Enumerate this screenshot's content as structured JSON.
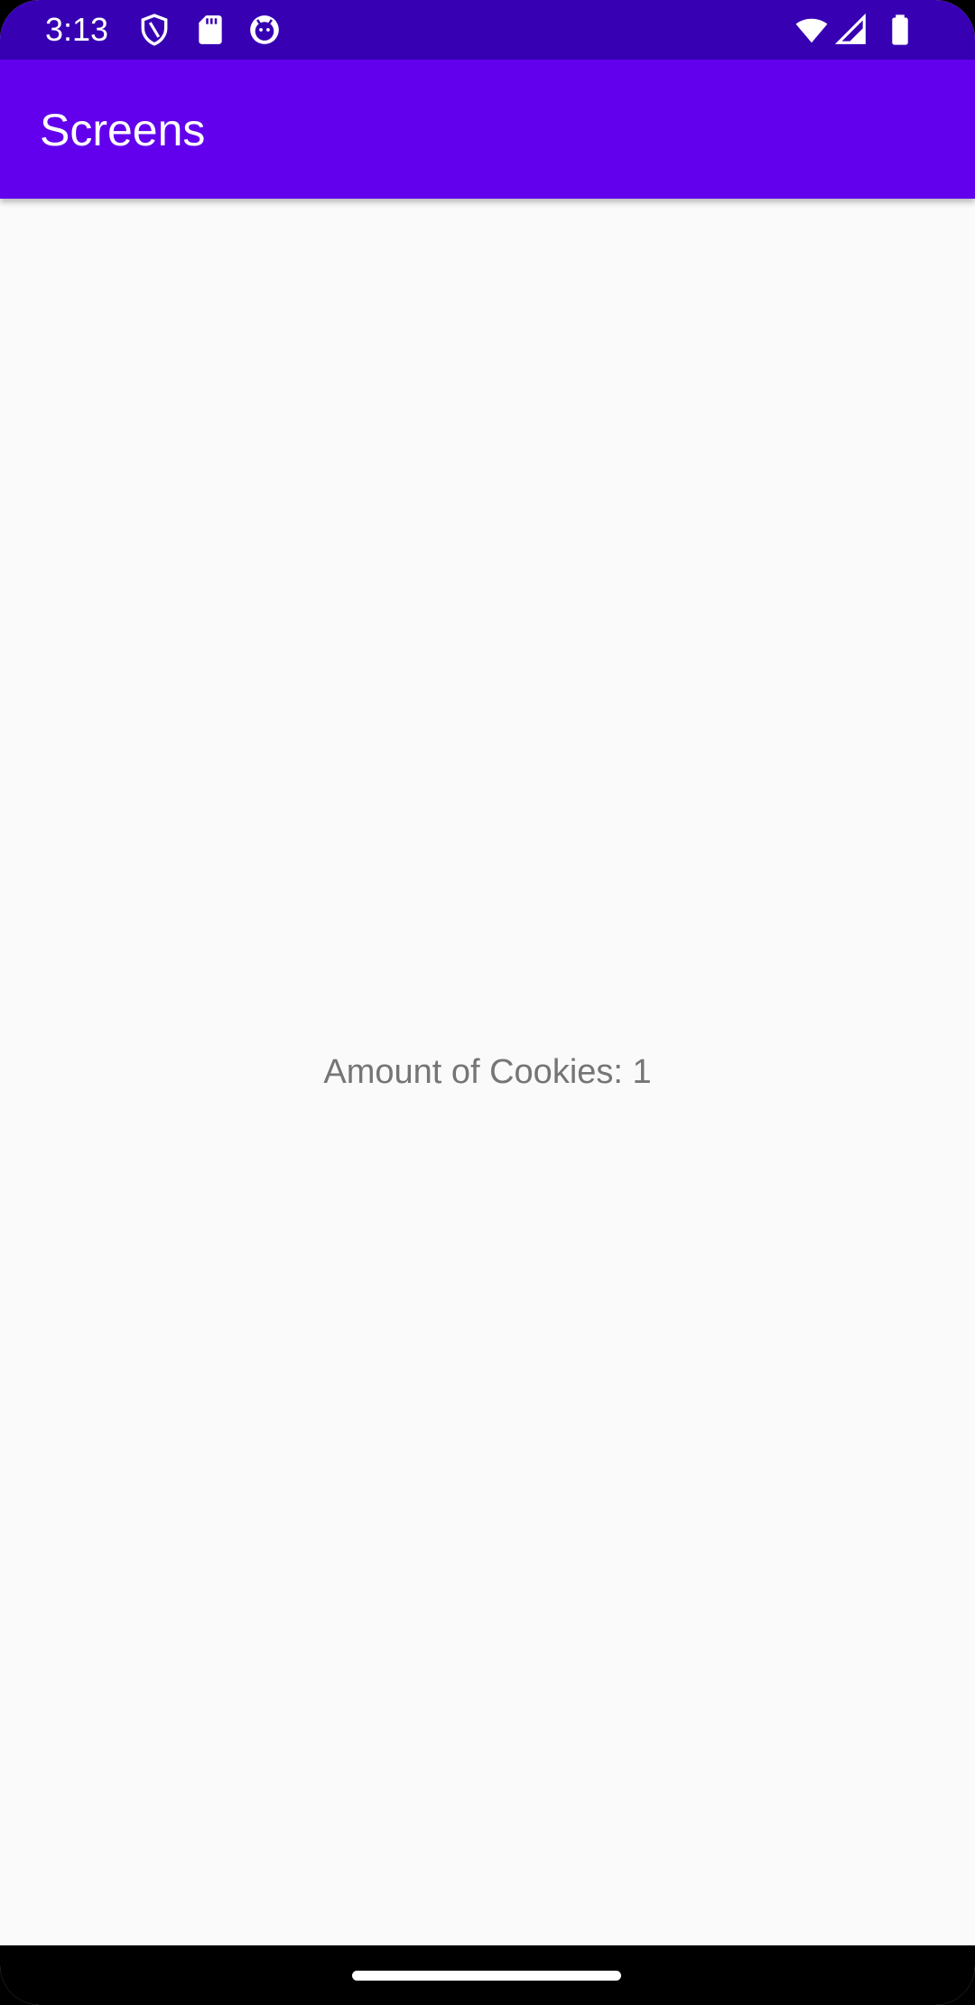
{
  "status_bar": {
    "time": "3:13",
    "icons_left": [
      "shield-icon",
      "sd-card-icon",
      "android-face-icon"
    ],
    "icons_right": [
      "wifi-icon",
      "cell-signal-icon",
      "battery-icon"
    ],
    "color": "#3700b3"
  },
  "app_bar": {
    "title": "Screens",
    "color": "#6200ee"
  },
  "main": {
    "cookie_text": "Amount of Cookies: 1"
  },
  "nav_bar": {
    "handle": "home-handle"
  }
}
